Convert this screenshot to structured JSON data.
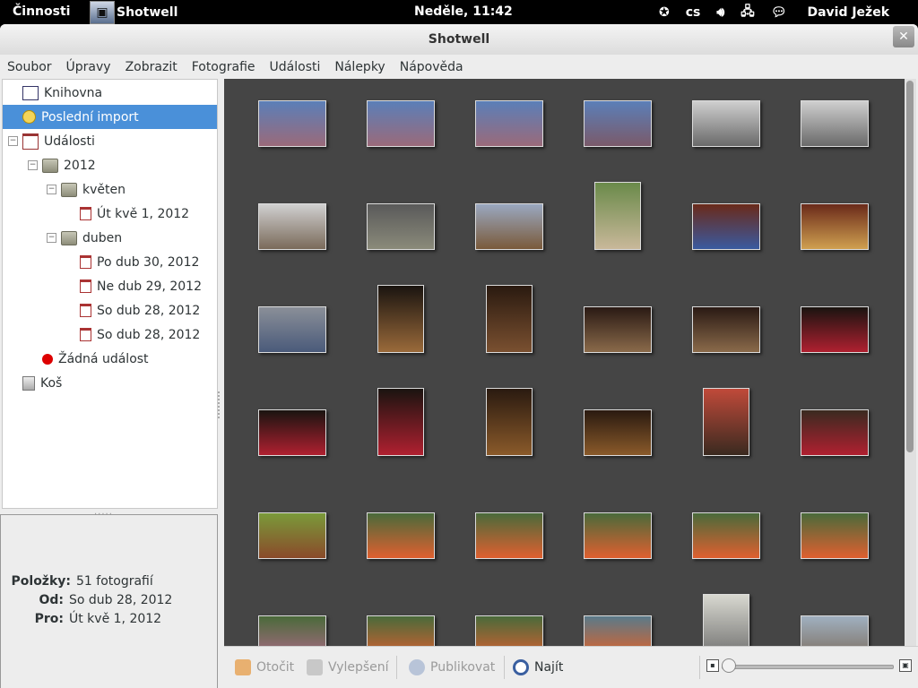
{
  "topbar": {
    "activities": "Činnosti",
    "app_name": "Shotwell",
    "clock": "Neděle, 11:42",
    "lang": "cs",
    "user": "David Ježek"
  },
  "window": {
    "title": "Shotwell",
    "close_glyph": "✕"
  },
  "menu": [
    "Soubor",
    "Úpravy",
    "Zobrazit",
    "Fotografie",
    "Události",
    "Nálepky",
    "Nápověda"
  ],
  "sidebar": {
    "items": [
      {
        "label": "Knihovna",
        "icon": "library-icon",
        "level": 0,
        "selected": false,
        "expander": ""
      },
      {
        "label": "Poslední import",
        "icon": "last-import-icon",
        "level": 0,
        "selected": true,
        "expander": ""
      },
      {
        "label": "Události",
        "icon": "events-icon",
        "level": 0,
        "selected": false,
        "expander": "−"
      },
      {
        "label": "2012",
        "icon": "folder-icon",
        "level": 1,
        "selected": false,
        "expander": "−"
      },
      {
        "label": "květen",
        "icon": "folder-icon",
        "level": 2,
        "selected": false,
        "expander": "−"
      },
      {
        "label": "Út kvě 1, 2012",
        "icon": "calendar-icon",
        "level": 3,
        "selected": false,
        "expander": ""
      },
      {
        "label": "duben",
        "icon": "folder-icon",
        "level": 2,
        "selected": false,
        "expander": "−"
      },
      {
        "label": "Po dub 30, 2012",
        "icon": "calendar-icon",
        "level": 3,
        "selected": false,
        "expander": ""
      },
      {
        "label": "Ne dub 29, 2012",
        "icon": "calendar-icon",
        "level": 3,
        "selected": false,
        "expander": ""
      },
      {
        "label": "So dub 28, 2012",
        "icon": "calendar-icon",
        "level": 3,
        "selected": false,
        "expander": ""
      },
      {
        "label": "So dub 28, 2012",
        "icon": "calendar-icon",
        "level": 3,
        "selected": false,
        "expander": ""
      },
      {
        "label": "Žádná událost",
        "icon": "no-event-icon",
        "level": 1,
        "selected": false,
        "expander": ""
      },
      {
        "label": "Koš",
        "icon": "trash-icon",
        "level": 0,
        "selected": false,
        "expander": ""
      }
    ]
  },
  "info": {
    "items_label": "Položky:",
    "items_value": "51 fotografií",
    "from_label": "Od:",
    "from_value": "So dub 28, 2012",
    "to_label": "Pro:",
    "to_value": "Út kvě 1, 2012"
  },
  "photos": [
    {
      "orient": "landscape",
      "colors": [
        "#5b7fb8",
        "#9a6a7a"
      ]
    },
    {
      "orient": "landscape",
      "colors": [
        "#5b7fb8",
        "#9a6a7a"
      ]
    },
    {
      "orient": "landscape",
      "colors": [
        "#5b7fb8",
        "#9a6a7a"
      ]
    },
    {
      "orient": "landscape",
      "colors": [
        "#5b7fb8",
        "#7a5a6a"
      ]
    },
    {
      "orient": "landscape",
      "colors": [
        "#cfcfcf",
        "#6a6a6a"
      ]
    },
    {
      "orient": "landscape",
      "colors": [
        "#cfcfcf",
        "#6a6a6a"
      ]
    },
    {
      "orient": "landscape",
      "colors": [
        "#d0d0d0",
        "#7a6a5a"
      ]
    },
    {
      "orient": "landscape",
      "colors": [
        "#5a5a5a",
        "#8a8a7a"
      ]
    },
    {
      "orient": "landscape",
      "colors": [
        "#9aa8c0",
        "#7a5a3a"
      ]
    },
    {
      "orient": "portrait",
      "colors": [
        "#6a8a4a",
        "#c9b89a"
      ]
    },
    {
      "orient": "landscape",
      "colors": [
        "#6a2a1a",
        "#3a5aa0"
      ]
    },
    {
      "orient": "landscape",
      "colors": [
        "#6a2a1a",
        "#d0a050"
      ]
    },
    {
      "orient": "landscape",
      "colors": [
        "#8a8f98",
        "#4a5a7a"
      ]
    },
    {
      "orient": "portrait",
      "colors": [
        "#1a1410",
        "#9a6a3a"
      ]
    },
    {
      "orient": "portrait",
      "colors": [
        "#2a1a10",
        "#7a5030"
      ]
    },
    {
      "orient": "landscape",
      "colors": [
        "#2a1a14",
        "#8a6a4a"
      ]
    },
    {
      "orient": "landscape",
      "colors": [
        "#2a1a14",
        "#8a6a4a"
      ]
    },
    {
      "orient": "landscape",
      "colors": [
        "#1a1410",
        "#b02030"
      ]
    },
    {
      "orient": "landscape",
      "colors": [
        "#1a1410",
        "#b02030"
      ]
    },
    {
      "orient": "portrait",
      "colors": [
        "#1a1410",
        "#b02030"
      ]
    },
    {
      "orient": "portrait",
      "colors": [
        "#2a1a10",
        "#8a5a2a"
      ]
    },
    {
      "orient": "landscape",
      "colors": [
        "#2a1a10",
        "#8a5a2a"
      ]
    },
    {
      "orient": "portrait",
      "colors": [
        "#c04a3a",
        "#3a2a20"
      ]
    },
    {
      "orient": "landscape",
      "colors": [
        "#3a2a20",
        "#b02030"
      ]
    },
    {
      "orient": "landscape",
      "colors": [
        "#7a9a3a",
        "#8a4a2a"
      ]
    },
    {
      "orient": "landscape",
      "colors": [
        "#4a6a3a",
        "#e06030"
      ]
    },
    {
      "orient": "landscape",
      "colors": [
        "#4a6a3a",
        "#e06030"
      ]
    },
    {
      "orient": "landscape",
      "colors": [
        "#4a6a3a",
        "#e06030"
      ]
    },
    {
      "orient": "landscape",
      "colors": [
        "#4a6a3a",
        "#e06030"
      ]
    },
    {
      "orient": "landscape",
      "colors": [
        "#4a6a3a",
        "#e06030"
      ]
    },
    {
      "orient": "landscape",
      "colors": [
        "#4a6a3a",
        "#b06a8a"
      ]
    },
    {
      "orient": "landscape",
      "colors": [
        "#4a6a3a",
        "#e06030"
      ]
    },
    {
      "orient": "landscape",
      "colors": [
        "#4a6a3a",
        "#e06030"
      ]
    },
    {
      "orient": "landscape",
      "colors": [
        "#5a7a8a",
        "#ea6020"
      ]
    },
    {
      "orient": "portrait",
      "colors": [
        "#d8d8d0",
        "#6a6a6a"
      ]
    },
    {
      "orient": "landscape",
      "colors": [
        "#a0b0c0",
        "#7a6a5a"
      ]
    }
  ],
  "toolbar": {
    "rotate": "Otočit",
    "enhance": "Vylepšení",
    "publish": "Publikovat",
    "find": "Najít"
  },
  "zoom_level": 0.0
}
